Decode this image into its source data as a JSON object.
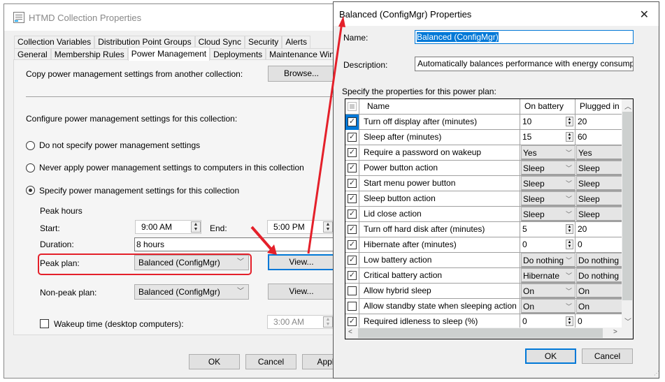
{
  "main_window": {
    "title": "HTMD Collection Properties",
    "tabs_row1": [
      "Collection Variables",
      "Distribution Point Groups",
      "Cloud Sync",
      "Security",
      "Alerts"
    ],
    "tabs_row2": [
      "General",
      "Membership Rules",
      "Power Management",
      "Deployments",
      "Maintenance Windows"
    ],
    "selected_tab": "Power Management",
    "copy_label": "Copy power management settings from another collection:",
    "browse_button": "Browse...",
    "configure_label": "Configure power management settings for this collection:",
    "radio_options": [
      {
        "label": "Do not specify power management settings",
        "selected": false
      },
      {
        "label": "Never apply power management settings to computers in this collection",
        "selected": false
      },
      {
        "label": "Specify power management settings for this collection",
        "selected": true
      }
    ],
    "peak_hours_label": "Peak hours",
    "start_label": "Start:",
    "start_value": "9:00 AM",
    "end_label": "End:",
    "end_value": "5:00 PM",
    "duration_label": "Duration:",
    "duration_value": "8 hours",
    "peak_plan_label": "Peak plan:",
    "peak_plan_value": "Balanced (ConfigMgr)",
    "view_button": "View...",
    "non_peak_plan_label": "Non-peak plan:",
    "non_peak_plan_value": "Balanced (ConfigMgr)",
    "wakeup_label": "Wakeup time (desktop computers):",
    "wakeup_checked": false,
    "wakeup_value": "3:00 AM",
    "ok_button": "OK",
    "cancel_button": "Cancel",
    "apply_button": "Apply"
  },
  "dialog": {
    "title": "Balanced (ConfigMgr) Properties",
    "name_label": "Name:",
    "name_value": "Balanced (ConfigMgr)",
    "description_label": "Description:",
    "description_value": "Automatically balances performance with energy consumption on",
    "specify_label": "Specify the properties for this power plan:",
    "columns": [
      "Name",
      "On battery",
      "Plugged in"
    ],
    "rows": [
      {
        "checked": true,
        "name": "Turn off display after (minutes)",
        "battery": "10",
        "plugged": "20",
        "type": "spin"
      },
      {
        "checked": true,
        "name": "Sleep after (minutes)",
        "battery": "15",
        "plugged": "60",
        "type": "spin"
      },
      {
        "checked": true,
        "name": "Require a password on wakeup",
        "battery": "Yes",
        "plugged": "Yes",
        "type": "combo"
      },
      {
        "checked": true,
        "name": "Power button action",
        "battery": "Sleep",
        "plugged": "Sleep",
        "type": "combo"
      },
      {
        "checked": true,
        "name": "Start menu power button",
        "battery": "Sleep",
        "plugged": "Sleep",
        "type": "combo"
      },
      {
        "checked": true,
        "name": "Sleep button action",
        "battery": "Sleep",
        "plugged": "Sleep",
        "type": "combo"
      },
      {
        "checked": true,
        "name": "Lid close action",
        "battery": "Sleep",
        "plugged": "Sleep",
        "type": "combo"
      },
      {
        "checked": true,
        "name": "Turn off hard disk after (minutes)",
        "battery": "5",
        "plugged": "20",
        "type": "spin"
      },
      {
        "checked": true,
        "name": "Hibernate after (minutes)",
        "battery": "0",
        "plugged": "0",
        "type": "spin"
      },
      {
        "checked": true,
        "name": "Low battery action",
        "battery": "Do nothing",
        "plugged": "Do nothing",
        "type": "combo"
      },
      {
        "checked": true,
        "name": "Critical battery action",
        "battery": "Hibernate",
        "plugged": "Do nothing",
        "type": "combo"
      },
      {
        "checked": false,
        "name": "Allow hybrid sleep",
        "battery": "On",
        "plugged": "On",
        "type": "combo"
      },
      {
        "checked": false,
        "name": "Allow standby state when sleeping action",
        "battery": "On",
        "plugged": "On",
        "type": "combo"
      },
      {
        "checked": true,
        "name": "Required idleness to sleep (%)",
        "battery": "0",
        "plugged": "0",
        "type": "spin"
      }
    ],
    "ok_button": "OK",
    "cancel_button": "Cancel"
  },
  "annotation_color": "#e4202a",
  "accent_color": "#0078d7"
}
